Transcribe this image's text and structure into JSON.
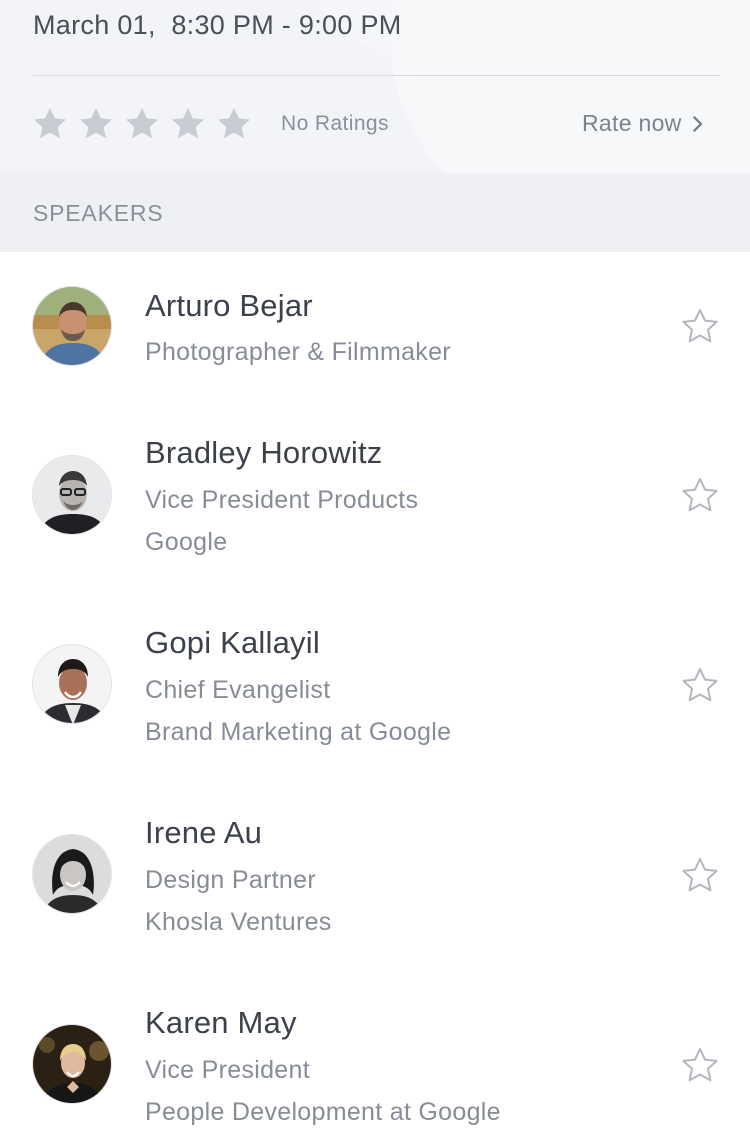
{
  "session": {
    "time_range": "March 01,  8:30 PM - 9:00 PM",
    "rating": {
      "stars": 5,
      "filled": 0,
      "status": "No Ratings",
      "rate_label": "Rate now"
    }
  },
  "section_title": "SPEAKERS",
  "speakers": [
    {
      "name": "Arturo Bejar",
      "line1": "Photographer & Filmmaker",
      "line2": ""
    },
    {
      "name": "Bradley Horowitz",
      "line1": "Vice President Products",
      "line2": "Google"
    },
    {
      "name": "Gopi Kallayil",
      "line1": "Chief Evangelist",
      "line2": "Brand Marketing at Google"
    },
    {
      "name": "Irene Au",
      "line1": "Design Partner",
      "line2": "Khosla Ventures"
    },
    {
      "name": "Karen May",
      "line1": "Vice President",
      "line2": "People Development at Google"
    }
  ],
  "colors": {
    "star_empty": "#c9ccd3",
    "text_primary": "#3d414c",
    "text_secondary": "#878c97"
  },
  "icons": {
    "rating_star": "star-icon",
    "chevron": "chevron-right-icon",
    "favorite": "star-outline-icon"
  }
}
